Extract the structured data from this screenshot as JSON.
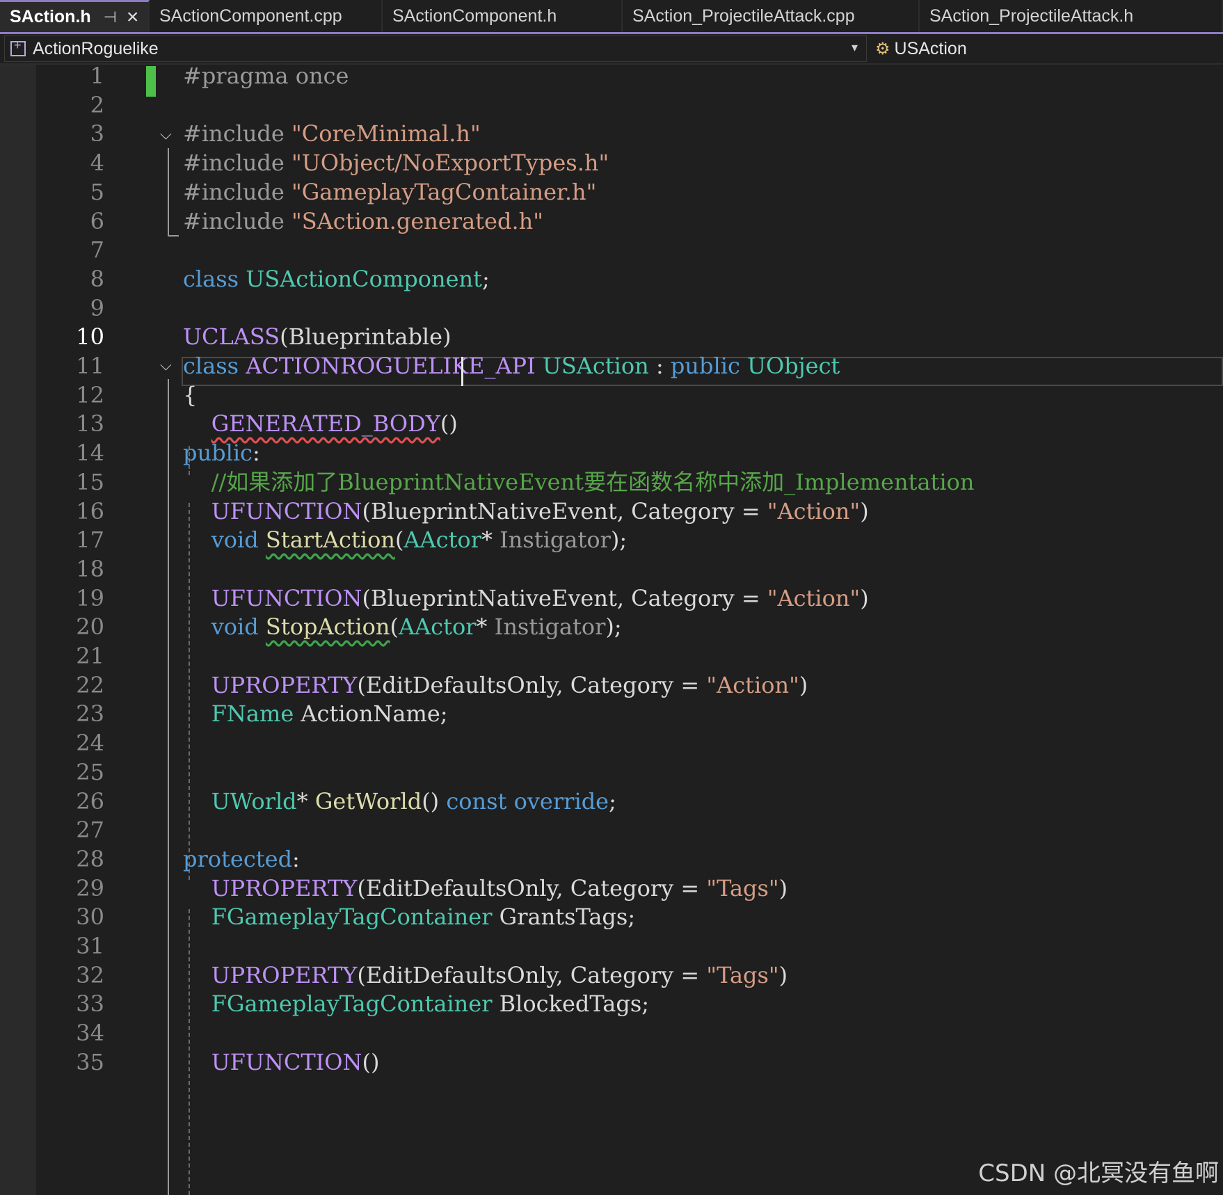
{
  "tabs": [
    {
      "label": "SAction.h",
      "active": true
    },
    {
      "label": "SActionComponent.cpp",
      "active": false
    },
    {
      "label": "SActionComponent.h",
      "active": false
    },
    {
      "label": "SAction_ProjectileAttack.cpp",
      "active": false
    },
    {
      "label": "SAction_ProjectileAttack.h",
      "active": false
    }
  ],
  "tab_icons": {
    "pin": "pin-icon",
    "close": "close-icon"
  },
  "navbar": {
    "project": "ActionRoguelike",
    "symbol": "USAction",
    "project_icon": "project-icon",
    "symbol_icon": "class-icon",
    "dropdown_icon": "chevron-down-icon"
  },
  "editor": {
    "current_line": 10,
    "line_numbers": [
      "1",
      "2",
      "3",
      "4",
      "5",
      "6",
      "7",
      "8",
      "9",
      "10",
      "11",
      "12",
      "13",
      "14",
      "15",
      "16",
      "17",
      "18",
      "19",
      "20",
      "21",
      "22",
      "23",
      "24",
      "25",
      "26",
      "27",
      "28",
      "29",
      "30",
      "31",
      "32",
      "33",
      "34",
      "35"
    ],
    "lines": [
      [
        {
          "t": "#pragma once",
          "c": "pp"
        }
      ],
      [],
      [
        {
          "t": "#include ",
          "c": "pp"
        },
        {
          "t": "\"CoreMinimal.h\"",
          "c": "st"
        }
      ],
      [
        {
          "t": "#include ",
          "c": "pp"
        },
        {
          "t": "\"UObject/NoExportTypes.h\"",
          "c": "st"
        }
      ],
      [
        {
          "t": "#include ",
          "c": "pp"
        },
        {
          "t": "\"GameplayTagContainer.h\"",
          "c": "st"
        }
      ],
      [
        {
          "t": "#include ",
          "c": "pp"
        },
        {
          "t": "\"SAction.generated.h\"",
          "c": "st"
        }
      ],
      [],
      [
        {
          "t": "class ",
          "c": "k"
        },
        {
          "t": "USActionComponent",
          "c": "ty"
        },
        {
          "t": ";",
          "c": "pl"
        }
      ],
      [],
      [
        {
          "t": "UCLASS",
          "c": "mc"
        },
        {
          "t": "(Blueprintable)",
          "c": "pl"
        }
      ],
      [
        {
          "t": "class ",
          "c": "k"
        },
        {
          "t": "ACTIONROGUELIKE_API",
          "c": "mc"
        },
        {
          "t": " ",
          "c": "pl"
        },
        {
          "t": "USAction",
          "c": "ty"
        },
        {
          "t": " : ",
          "c": "pl"
        },
        {
          "t": "public ",
          "c": "k"
        },
        {
          "t": "UObject",
          "c": "ty"
        }
      ],
      [
        {
          "t": "{",
          "c": "pl"
        }
      ],
      [
        {
          "t": "    ",
          "c": "pl"
        },
        {
          "t": "GENERATED_BODY",
          "c": "mc",
          "sq": "red"
        },
        {
          "t": "()",
          "c": "pl"
        }
      ],
      [
        {
          "t": "public",
          "c": "k"
        },
        {
          "t": ":",
          "c": "pl"
        }
      ],
      [
        {
          "t": "    ",
          "c": "pl"
        },
        {
          "t": "//如果添加了BlueprintNativeEvent要在函数名称中添加_Implementation",
          "c": "cm"
        }
      ],
      [
        {
          "t": "    ",
          "c": "pl"
        },
        {
          "t": "UFUNCTION",
          "c": "mc"
        },
        {
          "t": "(BlueprintNativeEvent, Category = ",
          "c": "pl"
        },
        {
          "t": "\"Action\"",
          "c": "st"
        },
        {
          "t": ")",
          "c": "pl"
        }
      ],
      [
        {
          "t": "    ",
          "c": "pl"
        },
        {
          "t": "void ",
          "c": "k"
        },
        {
          "t": "StartAction",
          "c": "fn",
          "sq": "green"
        },
        {
          "t": "(",
          "c": "pl"
        },
        {
          "t": "AActor",
          "c": "ty"
        },
        {
          "t": "* ",
          "c": "pl"
        },
        {
          "t": "Instigator",
          "c": "pa"
        },
        {
          "t": ");",
          "c": "pl"
        }
      ],
      [],
      [
        {
          "t": "    ",
          "c": "pl"
        },
        {
          "t": "UFUNCTION",
          "c": "mc"
        },
        {
          "t": "(BlueprintNativeEvent, Category = ",
          "c": "pl"
        },
        {
          "t": "\"Action\"",
          "c": "st"
        },
        {
          "t": ")",
          "c": "pl"
        }
      ],
      [
        {
          "t": "    ",
          "c": "pl"
        },
        {
          "t": "void ",
          "c": "k"
        },
        {
          "t": "StopAction",
          "c": "fn",
          "sq": "green"
        },
        {
          "t": "(",
          "c": "pl"
        },
        {
          "t": "AActor",
          "c": "ty"
        },
        {
          "t": "* ",
          "c": "pl"
        },
        {
          "t": "Instigator",
          "c": "pa"
        },
        {
          "t": ");",
          "c": "pl"
        }
      ],
      [],
      [
        {
          "t": "    ",
          "c": "pl"
        },
        {
          "t": "UPROPERTY",
          "c": "mc"
        },
        {
          "t": "(EditDefaultsOnly, Category = ",
          "c": "pl"
        },
        {
          "t": "\"Action\"",
          "c": "st"
        },
        {
          "t": ")",
          "c": "pl"
        }
      ],
      [
        {
          "t": "    ",
          "c": "pl"
        },
        {
          "t": "FName",
          "c": "ty"
        },
        {
          "t": " ActionName;",
          "c": "pl"
        }
      ],
      [],
      [],
      [
        {
          "t": "    ",
          "c": "pl"
        },
        {
          "t": "UWorld",
          "c": "ty"
        },
        {
          "t": "* ",
          "c": "pl"
        },
        {
          "t": "GetWorld",
          "c": "fn"
        },
        {
          "t": "() ",
          "c": "pl"
        },
        {
          "t": "const override",
          "c": "k"
        },
        {
          "t": ";",
          "c": "pl"
        }
      ],
      [],
      [
        {
          "t": "protected",
          "c": "k"
        },
        {
          "t": ":",
          "c": "pl"
        }
      ],
      [
        {
          "t": "    ",
          "c": "pl"
        },
        {
          "t": "UPROPERTY",
          "c": "mc"
        },
        {
          "t": "(EditDefaultsOnly, Category = ",
          "c": "pl"
        },
        {
          "t": "\"Tags\"",
          "c": "st"
        },
        {
          "t": ")",
          "c": "pl"
        }
      ],
      [
        {
          "t": "    ",
          "c": "pl"
        },
        {
          "t": "FGameplayTagContainer",
          "c": "ty"
        },
        {
          "t": " GrantsTags;",
          "c": "pl"
        }
      ],
      [],
      [
        {
          "t": "    ",
          "c": "pl"
        },
        {
          "t": "UPROPERTY",
          "c": "mc"
        },
        {
          "t": "(EditDefaultsOnly, Category = ",
          "c": "pl"
        },
        {
          "t": "\"Tags\"",
          "c": "st"
        },
        {
          "t": ")",
          "c": "pl"
        }
      ],
      [
        {
          "t": "    ",
          "c": "pl"
        },
        {
          "t": "FGameplayTagContainer",
          "c": "ty"
        },
        {
          "t": " BlockedTags;",
          "c": "pl"
        }
      ],
      [],
      [
        {
          "t": "    ",
          "c": "pl"
        },
        {
          "t": "UFUNCTION",
          "c": "mc"
        },
        {
          "t": "()",
          "c": "pl"
        }
      ]
    ]
  },
  "colors": {
    "background": "#1f1f1f",
    "accent": "#8e7cc3",
    "keyword": "#569cd6",
    "type": "#4ec9b0",
    "macro": "#bd91f5",
    "string": "#d69d85",
    "comment": "#57a64a",
    "function": "#dcdcaa",
    "change_marker": "#4ec04a"
  },
  "watermark": "CSDN @北冥没有鱼啊"
}
